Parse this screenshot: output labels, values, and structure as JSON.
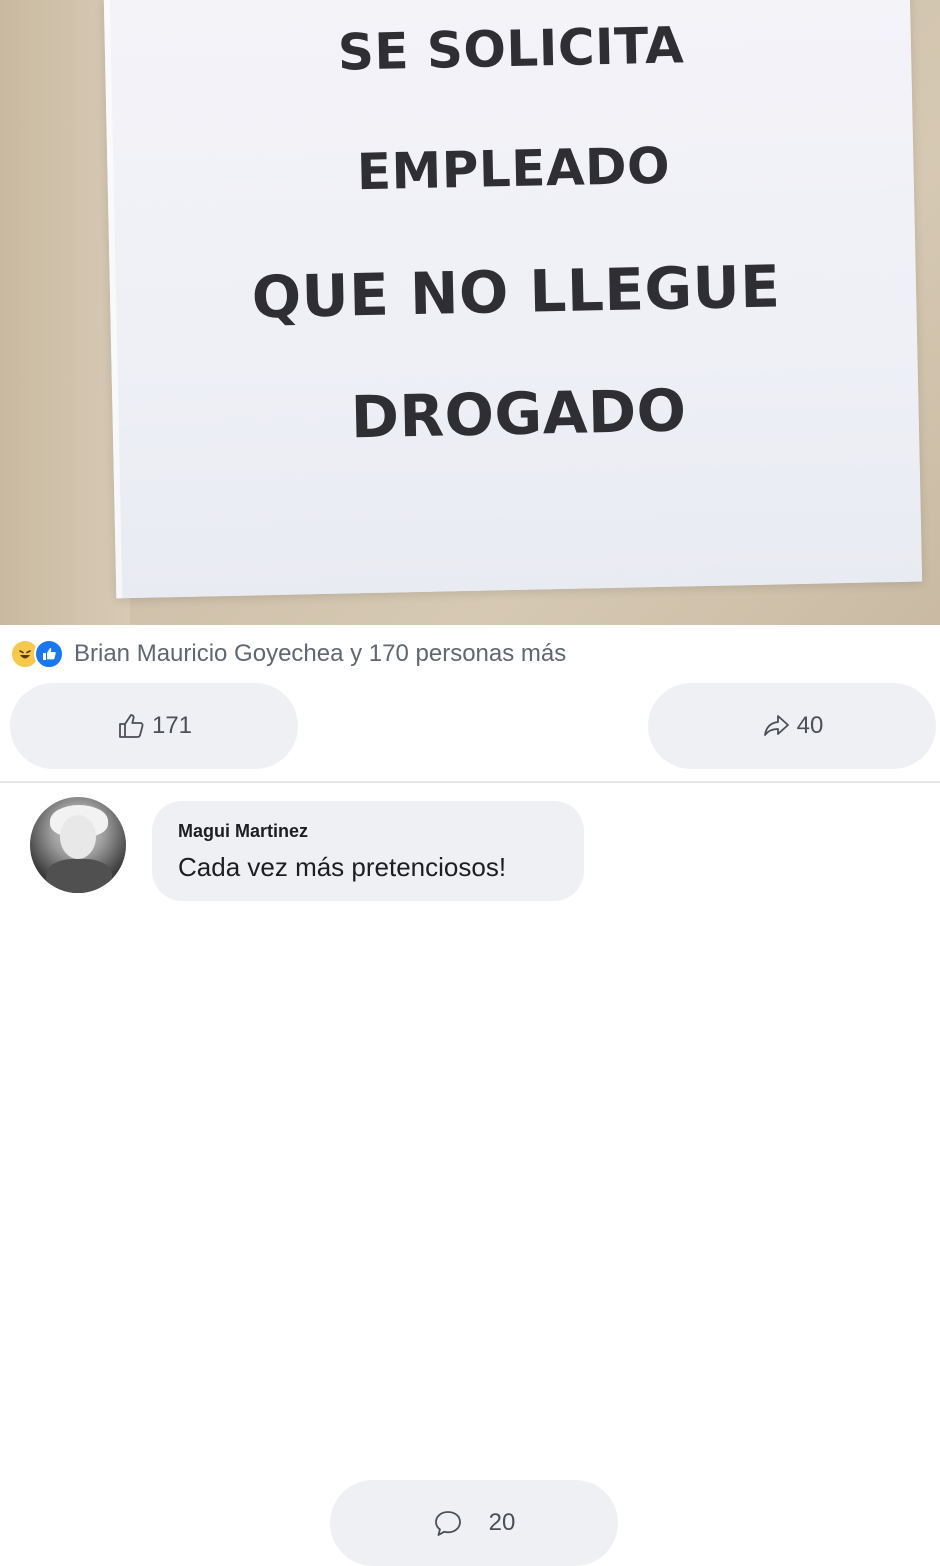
{
  "post": {
    "image_text": {
      "line1": "SE SOLICITA",
      "line2": "EMPLEADO",
      "line3": "QUE NO LLEGUE",
      "line4": "DROGADO"
    },
    "reactions": {
      "icons": [
        "haha-icon",
        "like-icon"
      ],
      "summary": "Brian Mauricio Goyechea y 170 personas más"
    },
    "actions": {
      "like_count": "171",
      "comment_count": "20",
      "share_count": "40"
    }
  },
  "comment": {
    "author": "Magui Martinez",
    "text": "Cada vez más pretenciosos!"
  },
  "colors": {
    "like_blue": "#1877f2",
    "haha_yellow": "#f7c94b",
    "pill_bg": "#eef0f3"
  }
}
